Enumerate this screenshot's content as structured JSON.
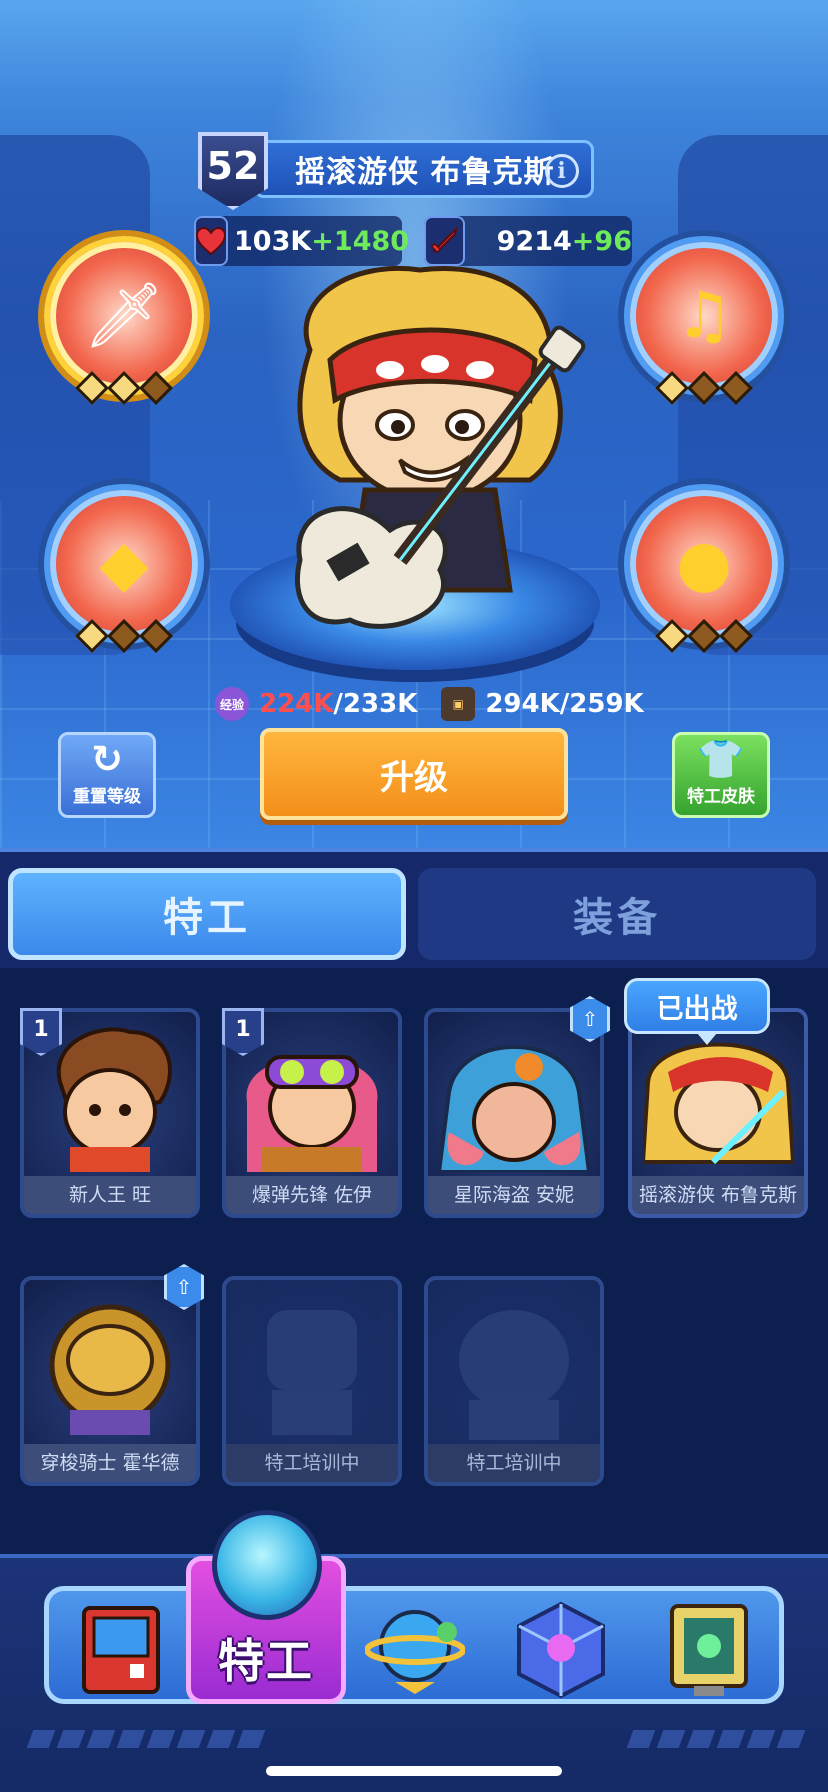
{
  "hero": {
    "level": "52",
    "name": "摇滚游侠 布鲁克斯",
    "hp_value": "103K",
    "hp_bonus": "+1480",
    "atk_value": "9214",
    "atk_bonus": "+96",
    "exp_current": "224K",
    "exp_required": "/233K",
    "cost_current": "294K",
    "cost_required": "/259K",
    "exp_icon_label": "经验"
  },
  "skills": [
    {
      "name": "sword-skill-icon",
      "stars_on": 2,
      "stars_total": 3
    },
    {
      "name": "music-note-skill-icon",
      "stars_on": 1,
      "stars_total": 3
    },
    {
      "name": "crystal-skill-icon",
      "stars_on": 1,
      "stars_total": 3
    },
    {
      "name": "gold-coin-skill-icon",
      "stars_on": 1,
      "stars_total": 3
    }
  ],
  "buttons": {
    "reset_label": "重置等级",
    "upgrade_label": "升级",
    "skin_label": "特工皮肤"
  },
  "tabs": {
    "agent": "特工",
    "equipment": "装备"
  },
  "deployed_label": "已出战",
  "roster": [
    {
      "name": "新人王 旺",
      "level": "1",
      "locked": false
    },
    {
      "name": "爆弹先锋 佐伊",
      "level": "1",
      "locked": false
    },
    {
      "name": "星际海盗 安妮",
      "level": "",
      "locked": false
    },
    {
      "name": "摇滚游侠 布鲁克斯",
      "level": "",
      "locked": false
    },
    {
      "name": "穿梭骑士 霍华德",
      "level": "",
      "locked": false
    },
    {
      "name": "特工培训中",
      "level": "",
      "locked": true
    },
    {
      "name": "特工培训中",
      "level": "",
      "locked": true
    }
  ],
  "nav": {
    "active_label": "特工"
  },
  "colors": {
    "upgrade": "#f38f1b",
    "skin": "#34a32e",
    "hp_bonus": "#6eea5a",
    "exp_current": "#ff4e4e"
  }
}
